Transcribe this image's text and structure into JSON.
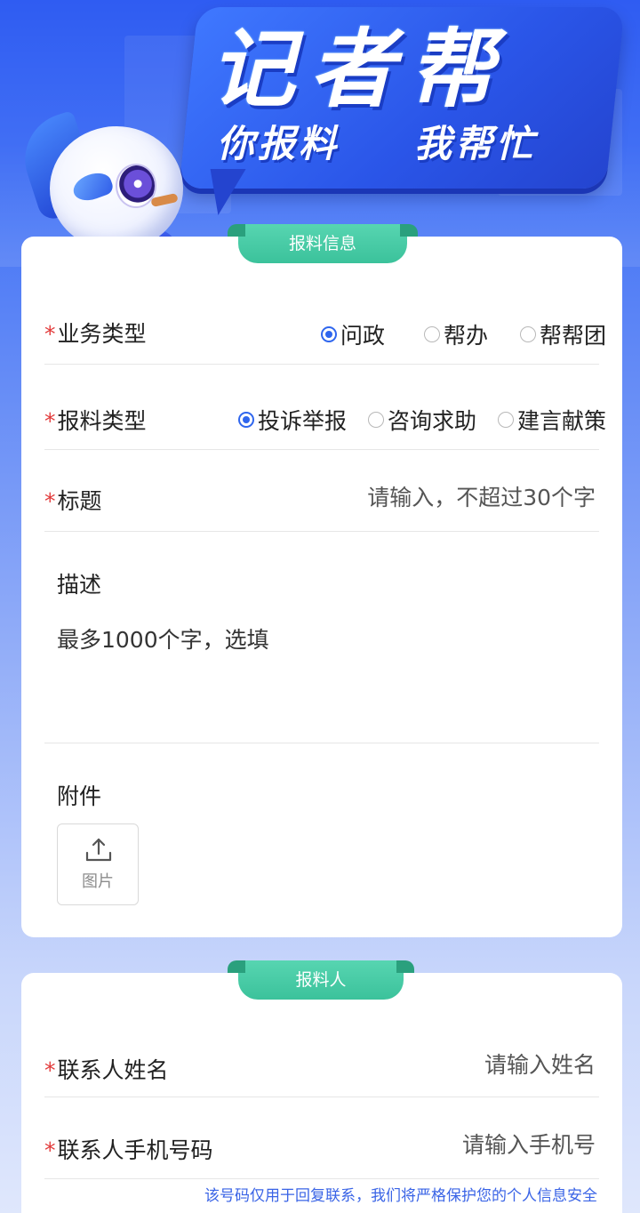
{
  "header": {
    "title": "记者帮",
    "slogan_left": "你报料",
    "slogan_right": "我帮忙"
  },
  "report_info": {
    "section_title": "报料信息",
    "business_type": {
      "label": "业务类型",
      "options": [
        "问政",
        "帮办",
        "帮帮团"
      ],
      "selected": "问政"
    },
    "report_type": {
      "label": "报料类型",
      "options": [
        "投诉举报",
        "咨询求助",
        "建言献策"
      ],
      "selected": "投诉举报"
    },
    "title_field": {
      "label": "标题",
      "placeholder": "请输入，不超过30个字"
    },
    "description": {
      "label": "描述",
      "placeholder": "最多1000个字，选填"
    },
    "attachment": {
      "label": "附件",
      "upload_label": "图片"
    }
  },
  "reporter": {
    "section_title": "报料人",
    "name_field": {
      "label": "联系人姓名",
      "placeholder": "请输入姓名"
    },
    "phone_field": {
      "label": "联系人手机号码",
      "placeholder": "请输入手机号"
    },
    "privacy_note": "该号码仅用于回复联系，我们将严格保护您的个人信息安全"
  },
  "colors": {
    "accent": "#2f66ee",
    "tab": "#3bc29b",
    "required": "#e23b3b"
  },
  "icons": [
    "upload-icon",
    "mascot"
  ]
}
